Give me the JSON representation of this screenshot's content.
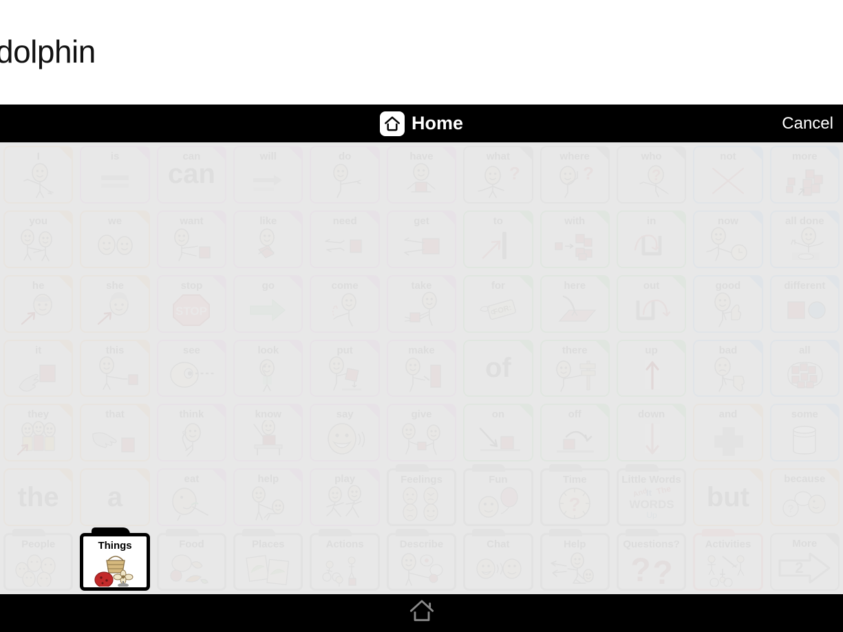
{
  "message": {
    "text": "dolphin"
  },
  "header": {
    "home_label": "Home",
    "home_icon": "home-icon",
    "cancel_label": "Cancel"
  },
  "footer": {
    "home_icon": "home-icon"
  },
  "colors": {
    "pronoun_border": "#edc9a3",
    "verb_border": "#e6b8e6",
    "question_border": "#bdbdbd",
    "preposition_border": "#a8dcaa",
    "descriptor_border": "#a9cdeb",
    "folder_border": "#b9b9b9",
    "activities_border": "#edb7b7",
    "selected_border": "#000000",
    "grid_background": "#e8e8e8",
    "bar_background": "#000000"
  },
  "grid": {
    "columns": 11,
    "rows": 7,
    "cells": [
      {
        "label": "I",
        "kind": "tile",
        "color": "pronoun_border",
        "art": "person-pointing-self",
        "selected": false
      },
      {
        "label": "is",
        "kind": "tile",
        "color": "verb_border",
        "art": "equals-bars",
        "selected": false
      },
      {
        "label": "can",
        "kind": "tile",
        "color": "verb_border",
        "art": "bigword",
        "word": "can",
        "selected": false
      },
      {
        "label": "will",
        "kind": "tile",
        "color": "verb_border",
        "art": "arrow-right-bar",
        "selected": false
      },
      {
        "label": "do",
        "kind": "tile",
        "color": "verb_border",
        "art": "person-reaching",
        "selected": false
      },
      {
        "label": "have",
        "kind": "tile",
        "color": "verb_border",
        "art": "person-holding-box",
        "selected": false
      },
      {
        "label": "what",
        "kind": "tile",
        "color": "question_border",
        "art": "person-question",
        "selected": false
      },
      {
        "label": "where",
        "kind": "tile",
        "color": "question_border",
        "art": "person-looking-question",
        "selected": false
      },
      {
        "label": "who",
        "kind": "tile",
        "color": "question_border",
        "art": "person-face-question",
        "selected": false
      },
      {
        "label": "not",
        "kind": "tile",
        "color": "descriptor_border",
        "art": "red-x",
        "selected": false
      },
      {
        "label": "more",
        "kind": "tile",
        "color": "descriptor_border",
        "art": "blocks-more",
        "selected": false
      },
      {
        "label": "you",
        "kind": "tile",
        "color": "pronoun_border",
        "art": "two-people-pointing",
        "selected": false
      },
      {
        "label": "we",
        "kind": "tile",
        "color": "pronoun_border",
        "art": "two-faces",
        "selected": false
      },
      {
        "label": "want",
        "kind": "tile",
        "color": "verb_border",
        "art": "person-reaching-box",
        "selected": false
      },
      {
        "label": "like",
        "kind": "tile",
        "color": "verb_border",
        "art": "person-hugging-heart",
        "selected": false
      },
      {
        "label": "need",
        "kind": "tile",
        "color": "verb_border",
        "art": "hands-reaching-box",
        "selected": false
      },
      {
        "label": "get",
        "kind": "tile",
        "color": "verb_border",
        "art": "hands-grabbing-box",
        "selected": false
      },
      {
        "label": "to",
        "kind": "tile",
        "color": "preposition_border",
        "art": "arrow-to-wall",
        "selected": false
      },
      {
        "label": "with",
        "kind": "tile",
        "color": "preposition_border",
        "art": "blocks-joining",
        "selected": false
      },
      {
        "label": "in",
        "kind": "tile",
        "color": "preposition_border",
        "art": "arrow-into-container",
        "selected": false
      },
      {
        "label": "now",
        "kind": "tile",
        "color": "descriptor_border",
        "art": "person-clock",
        "selected": false
      },
      {
        "label": "all done",
        "kind": "tile",
        "color": "descriptor_border",
        "art": "person-hands-up-plate",
        "selected": false
      },
      {
        "label": "he",
        "kind": "tile",
        "color": "pronoun_border",
        "art": "boy-face-arrow",
        "selected": false
      },
      {
        "label": "she",
        "kind": "tile",
        "color": "pronoun_border",
        "art": "girl-face-arrow",
        "selected": false
      },
      {
        "label": "stop",
        "kind": "tile",
        "color": "verb_border",
        "art": "stop-sign",
        "selected": false
      },
      {
        "label": "go",
        "kind": "tile",
        "color": "verb_border",
        "art": "green-arrow",
        "selected": false
      },
      {
        "label": "come",
        "kind": "tile",
        "color": "verb_border",
        "art": "person-beckoning",
        "selected": false
      },
      {
        "label": "take",
        "kind": "tile",
        "color": "verb_border",
        "art": "person-taking-cup",
        "selected": false
      },
      {
        "label": "for",
        "kind": "tile",
        "color": "preposition_border",
        "art": "gift-tag",
        "selected": false
      },
      {
        "label": "here",
        "kind": "tile",
        "color": "preposition_border",
        "art": "arrow-to-mat",
        "selected": false
      },
      {
        "label": "out",
        "kind": "tile",
        "color": "preposition_border",
        "art": "arrow-out-container",
        "selected": false
      },
      {
        "label": "good",
        "kind": "tile",
        "color": "descriptor_border",
        "art": "person-thumbs-up",
        "selected": false
      },
      {
        "label": "different",
        "kind": "tile",
        "color": "descriptor_border",
        "art": "square-and-circle",
        "selected": false
      },
      {
        "label": "it",
        "kind": "tile",
        "color": "pronoun_border",
        "art": "hand-pointing-box",
        "selected": false
      },
      {
        "label": "this",
        "kind": "tile",
        "color": "pronoun_border",
        "art": "person-pointing-box",
        "selected": false
      },
      {
        "label": "see",
        "kind": "tile",
        "color": "verb_border",
        "art": "eye-dashed-line",
        "selected": false
      },
      {
        "label": "look",
        "kind": "tile",
        "color": "verb_border",
        "art": "person-shading-eyes",
        "selected": false
      },
      {
        "label": "put",
        "kind": "tile",
        "color": "verb_border",
        "art": "person-placing-box",
        "selected": false
      },
      {
        "label": "make",
        "kind": "tile",
        "color": "verb_border",
        "art": "person-hammering",
        "selected": false
      },
      {
        "label": "",
        "kind": "tile",
        "color": "preposition_border",
        "art": "bigword",
        "word": "of",
        "selected": false
      },
      {
        "label": "there",
        "kind": "tile",
        "color": "preposition_border",
        "art": "person-pointing-sign",
        "selected": false
      },
      {
        "label": "up",
        "kind": "tile",
        "color": "preposition_border",
        "art": "arrow-up",
        "selected": false
      },
      {
        "label": "bad",
        "kind": "tile",
        "color": "descriptor_border",
        "art": "person-thumbs-down",
        "selected": false
      },
      {
        "label": "all",
        "kind": "tile",
        "color": "descriptor_border",
        "art": "many-blocks-circled",
        "selected": false
      },
      {
        "label": "they",
        "kind": "tile",
        "color": "pronoun_border",
        "art": "three-people-arrow",
        "selected": false
      },
      {
        "label": "that",
        "kind": "tile",
        "color": "pronoun_border",
        "art": "hand-pointing-far-box",
        "selected": false
      },
      {
        "label": "think",
        "kind": "tile",
        "color": "verb_border",
        "art": "person-thinking",
        "selected": false
      },
      {
        "label": "know",
        "kind": "tile",
        "color": "verb_border",
        "art": "person-hand-raised-desk",
        "selected": false
      },
      {
        "label": "say",
        "kind": "tile",
        "color": "verb_border",
        "art": "face-talking",
        "selected": false
      },
      {
        "label": "give",
        "kind": "tile",
        "color": "verb_border",
        "art": "two-people-giving",
        "selected": false
      },
      {
        "label": "on",
        "kind": "tile",
        "color": "preposition_border",
        "art": "arrow-onto-box",
        "selected": false
      },
      {
        "label": "off",
        "kind": "tile",
        "color": "preposition_border",
        "art": "arrow-off-box",
        "selected": false
      },
      {
        "label": "down",
        "kind": "tile",
        "color": "preposition_border",
        "art": "arrow-down",
        "selected": false
      },
      {
        "label": "and",
        "kind": "tile",
        "color": "pronoun_border",
        "art": "plus-sign",
        "selected": false
      },
      {
        "label": "some",
        "kind": "tile",
        "color": "descriptor_border",
        "art": "cylinder-partial",
        "selected": false
      },
      {
        "label": "",
        "kind": "tile",
        "color": "pronoun_border",
        "art": "bigword",
        "word": "the",
        "selected": false
      },
      {
        "label": "",
        "kind": "tile",
        "color": "pronoun_border",
        "art": "bigword",
        "word": "a",
        "selected": false
      },
      {
        "label": "eat",
        "kind": "tile",
        "color": "verb_border",
        "art": "person-eating",
        "selected": false
      },
      {
        "label": "help",
        "kind": "tile",
        "color": "verb_border",
        "art": "person-helping",
        "selected": false
      },
      {
        "label": "play",
        "kind": "tile",
        "color": "verb_border",
        "art": "people-running",
        "selected": false
      },
      {
        "label": "Feelings",
        "kind": "folder",
        "color": "folder_border",
        "art": "four-emotion-faces",
        "selected": false
      },
      {
        "label": "Fun",
        "kind": "folder",
        "color": "folder_border",
        "art": "face-balloon",
        "selected": false
      },
      {
        "label": "Time",
        "kind": "folder",
        "color": "folder_border",
        "art": "clock-question",
        "selected": false
      },
      {
        "label": "Little Words",
        "kind": "folder",
        "color": "folder_border",
        "art": "words-collage",
        "selected": false
      },
      {
        "label": "",
        "kind": "tile",
        "color": "pronoun_border",
        "art": "bigword",
        "word": "but",
        "selected": false
      },
      {
        "label": "because",
        "kind": "tile",
        "color": "pronoun_border",
        "art": "speech-bubbles-question",
        "selected": false
      },
      {
        "label": "People",
        "kind": "folder",
        "color": "folder_border",
        "art": "group-faces",
        "selected": false
      },
      {
        "label": "Things",
        "kind": "folder",
        "color": "selected_border",
        "art": "basket-ball-fan",
        "selected": true
      },
      {
        "label": "Food",
        "kind": "folder",
        "color": "folder_border",
        "art": "food-items",
        "selected": false
      },
      {
        "label": "Places",
        "kind": "folder",
        "color": "folder_border",
        "art": "maps",
        "selected": false
      },
      {
        "label": "Actions",
        "kind": "folder",
        "color": "folder_border",
        "art": "people-activities",
        "selected": false
      },
      {
        "label": "Describe",
        "kind": "folder",
        "color": "folder_border",
        "art": "person-describing",
        "selected": false
      },
      {
        "label": "Chat",
        "kind": "folder",
        "color": "folder_border",
        "art": "two-faces-talking",
        "selected": false
      },
      {
        "label": "Help",
        "kind": "folder",
        "color": "folder_border",
        "art": "hands-helping-person",
        "selected": false
      },
      {
        "label": "Questions?",
        "kind": "folder",
        "color": "folder_border",
        "art": "two-question-marks",
        "selected": false
      },
      {
        "label": "Activities",
        "kind": "folder",
        "color": "activities_border",
        "art": "sports-people",
        "selected": false
      },
      {
        "label": "More",
        "kind": "tile",
        "color": "folder_border",
        "art": "next-page-arrow",
        "page": "2",
        "selected": false
      }
    ]
  }
}
